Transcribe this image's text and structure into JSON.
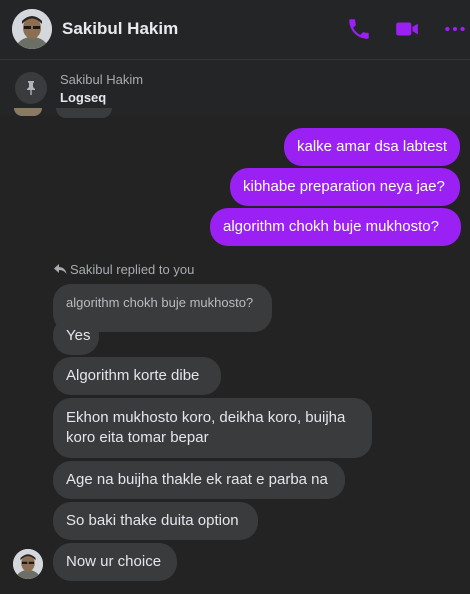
{
  "header": {
    "contact_name": "Sakibul Hakim",
    "icons": [
      "phone-icon",
      "video-icon",
      "more-icon"
    ],
    "accent_color": "#9b20f3"
  },
  "pinned": {
    "sender": "Sakibul Hakim",
    "text": "Logseq",
    "icon": "pin-icon"
  },
  "messages_out": [
    "kalke amar dsa labtest",
    "kibhabe preparation neya jae?",
    "algorithm chokh buje mukhosto?"
  ],
  "reply": {
    "label": "Sakibul replied to you",
    "quoted": "algorithm chokh buje mukhosto?"
  },
  "messages_in": [
    "Yes",
    "Algorithm korte dibe",
    "Ekhon mukhosto koro, deikha koro, buijha koro eita tomar bepar",
    "Age na buijha thakle ek raat e parba na",
    "So baki thake duita option",
    "Now ur choice"
  ]
}
